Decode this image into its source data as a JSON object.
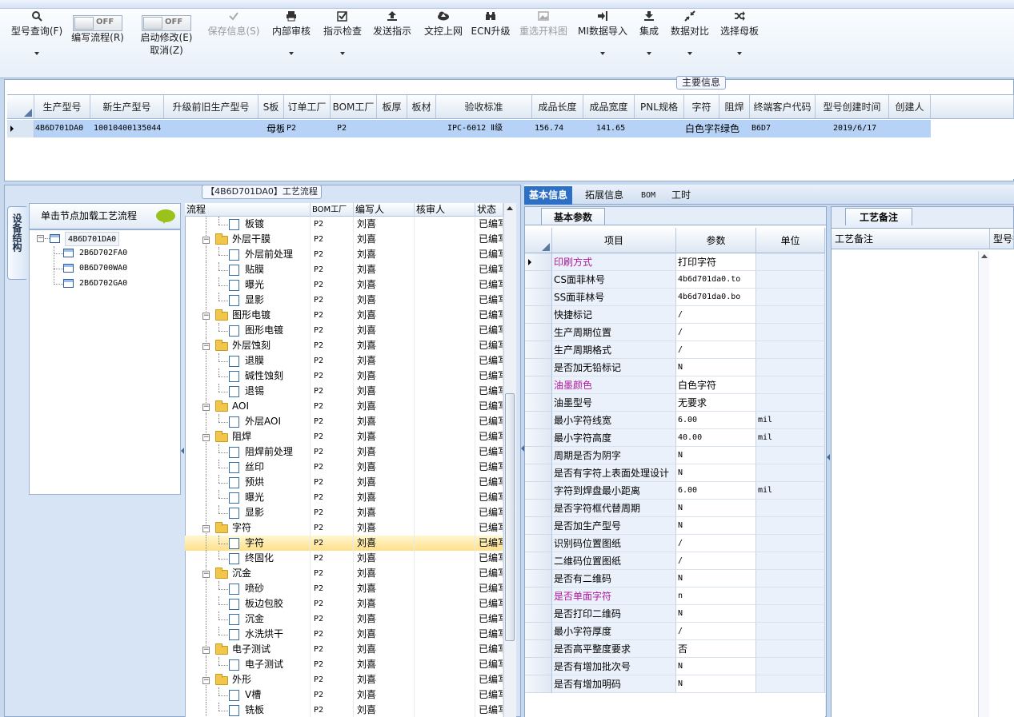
{
  "toolbar": {
    "query": "型号查询(F)",
    "edit_flow": "编写流程(R)",
    "edit_flow_toggle": "OFF",
    "enable_modify": "启动修改(E)",
    "enable_modify_toggle": "OFF",
    "cancel": "取消(Z)",
    "save_info": "保存信息(S)",
    "internal_review": "内部审核",
    "instruction_check": "指示检查",
    "send_instruction": "发送指示",
    "doc_upload": "文控上网",
    "ecn_upgrade": "ECN升级",
    "reselect_cut": "重选开料图",
    "mi_import": "MI数据导入",
    "integrate": "集成",
    "data_compare": "数据对比",
    "select_master": "选择母板"
  },
  "main_info": {
    "label": "主要信息",
    "columns": [
      "生产型号",
      "新生产型号",
      "升级前旧生产型号",
      "S板",
      "订单工厂",
      "BOM工厂",
      "板厚",
      "板材",
      "验收标准",
      "成品长度",
      "成品宽度",
      "PNL规格",
      "字符",
      "阻焊",
      "终端客户代码",
      "型号创建时间",
      "创建人"
    ],
    "row": {
      "model": "4B6D701DA0",
      "new_model": "10010400135044",
      "old_model": "",
      "s_board": "母板",
      "order_factory": "P2",
      "bom_factory": "P2",
      "thickness": "",
      "material": "",
      "standard": "IPC-6012 Ⅱ级",
      "length": "156.74",
      "width": "141.65",
      "pnl": "",
      "char": "白色字符",
      "solder": "绿色",
      "customer": "B6D7",
      "created": "2019/6/17",
      "creator": ""
    }
  },
  "tree": {
    "side_tab": "设备结构",
    "header": "单击节点加载工艺流程",
    "root": "4B6D701DA0",
    "children": [
      "2B6D702FA0",
      "0B6D700WA0",
      "2B6D702GA0"
    ]
  },
  "flow": {
    "title": "【4B6D701DA0】工艺流程",
    "columns": [
      "流程",
      "BOM工厂",
      "编写人",
      "核审人",
      "状态"
    ],
    "rows": [
      {
        "name": "板镀",
        "type": "child",
        "bom": "P2",
        "writer": "刘喜",
        "reviewer": "",
        "status": "已编写"
      },
      {
        "name": "外层干膜",
        "type": "group",
        "bom": "P2",
        "writer": "刘喜",
        "reviewer": "",
        "status": "已编写"
      },
      {
        "name": "外层前处理",
        "type": "child",
        "bom": "P2",
        "writer": "刘喜",
        "reviewer": "",
        "status": "已编写"
      },
      {
        "name": "贴膜",
        "type": "child",
        "bom": "P2",
        "writer": "刘喜",
        "reviewer": "",
        "status": "已编写"
      },
      {
        "name": "曝光",
        "type": "child",
        "bom": "P2",
        "writer": "刘喜",
        "reviewer": "",
        "status": "已编写"
      },
      {
        "name": "显影",
        "type": "child",
        "bom": "P2",
        "writer": "刘喜",
        "reviewer": "",
        "status": "已编写"
      },
      {
        "name": "图形电镀",
        "type": "group",
        "bom": "P2",
        "writer": "刘喜",
        "reviewer": "",
        "status": "已编写"
      },
      {
        "name": "图形电镀",
        "type": "child",
        "bom": "P2",
        "writer": "刘喜",
        "reviewer": "",
        "status": "已编写"
      },
      {
        "name": "外层蚀刻",
        "type": "group",
        "bom": "P2",
        "writer": "刘喜",
        "reviewer": "",
        "status": "已编写"
      },
      {
        "name": "退膜",
        "type": "child",
        "bom": "P2",
        "writer": "刘喜",
        "reviewer": "",
        "status": "已编写"
      },
      {
        "name": "碱性蚀刻",
        "type": "child",
        "bom": "P2",
        "writer": "刘喜",
        "reviewer": "",
        "status": "已编写"
      },
      {
        "name": "退锡",
        "type": "child",
        "bom": "P2",
        "writer": "刘喜",
        "reviewer": "",
        "status": "已编写"
      },
      {
        "name": "AOI",
        "type": "group",
        "bom": "P2",
        "writer": "刘喜",
        "reviewer": "",
        "status": "已编写"
      },
      {
        "name": "外层AOI",
        "type": "child",
        "bom": "P2",
        "writer": "刘喜",
        "reviewer": "",
        "status": "已编写"
      },
      {
        "name": "阻焊",
        "type": "group",
        "bom": "P2",
        "writer": "刘喜",
        "reviewer": "",
        "status": "已编写"
      },
      {
        "name": "阻焊前处理",
        "type": "child",
        "bom": "P2",
        "writer": "刘喜",
        "reviewer": "",
        "status": "已编写"
      },
      {
        "name": "丝印",
        "type": "child",
        "bom": "P2",
        "writer": "刘喜",
        "reviewer": "",
        "status": "已编写"
      },
      {
        "name": "预烘",
        "type": "child",
        "bom": "P2",
        "writer": "刘喜",
        "reviewer": "",
        "status": "已编写"
      },
      {
        "name": "曝光",
        "type": "child",
        "bom": "P2",
        "writer": "刘喜",
        "reviewer": "",
        "status": "已编写"
      },
      {
        "name": "显影",
        "type": "child",
        "bom": "P2",
        "writer": "刘喜",
        "reviewer": "",
        "status": "已编写"
      },
      {
        "name": "字符",
        "type": "group",
        "bom": "P2",
        "writer": "刘喜",
        "reviewer": "",
        "status": "已编写"
      },
      {
        "name": "字符",
        "type": "child",
        "bom": "P2",
        "writer": "刘喜",
        "reviewer": "",
        "status": "已编写",
        "selected": true
      },
      {
        "name": "终固化",
        "type": "child",
        "bom": "P2",
        "writer": "刘喜",
        "reviewer": "",
        "status": "已编写"
      },
      {
        "name": "沉金",
        "type": "group",
        "bom": "P2",
        "writer": "刘喜",
        "reviewer": "",
        "status": "已编写"
      },
      {
        "name": "喷砂",
        "type": "child",
        "bom": "P2",
        "writer": "刘喜",
        "reviewer": "",
        "status": "已编写"
      },
      {
        "name": "板边包胶",
        "type": "child",
        "bom": "P2",
        "writer": "刘喜",
        "reviewer": "",
        "status": "已编写"
      },
      {
        "name": "沉金",
        "type": "child",
        "bom": "P2",
        "writer": "刘喜",
        "reviewer": "",
        "status": "已编写"
      },
      {
        "name": "水洗烘干",
        "type": "child",
        "bom": "P2",
        "writer": "刘喜",
        "reviewer": "",
        "status": "已编写"
      },
      {
        "name": "电子测试",
        "type": "group",
        "bom": "P2",
        "writer": "刘喜",
        "reviewer": "",
        "status": "已编写"
      },
      {
        "name": "电子测试",
        "type": "child",
        "bom": "P2",
        "writer": "刘喜",
        "reviewer": "",
        "status": "已编写"
      },
      {
        "name": "外形",
        "type": "group",
        "bom": "P2",
        "writer": "刘喜",
        "reviewer": "",
        "status": "已编写"
      },
      {
        "name": "V槽",
        "type": "child",
        "bom": "P2",
        "writer": "刘喜",
        "reviewer": "",
        "status": "已编写"
      },
      {
        "name": "铣板",
        "type": "child",
        "bom": "P2",
        "writer": "刘喜",
        "reviewer": "",
        "status": "已编写"
      }
    ]
  },
  "right_tabs": [
    "基本信息",
    "拓展信息",
    "BOM",
    "工时"
  ],
  "basic": {
    "tab": "基本参数",
    "columns": [
      "项目",
      "参数",
      "单位"
    ],
    "rows": [
      {
        "item": "印刷方式",
        "value": "打印字符",
        "unit": "",
        "highlight": true
      },
      {
        "item": "CS面菲林号",
        "value": "4b6d701da0.to",
        "unit": ""
      },
      {
        "item": "SS面菲林号",
        "value": "4b6d701da0.bo",
        "unit": ""
      },
      {
        "item": "快捷标记",
        "value": "/",
        "unit": ""
      },
      {
        "item": "生产周期位置",
        "value": "/",
        "unit": ""
      },
      {
        "item": "生产周期格式",
        "value": "/",
        "unit": ""
      },
      {
        "item": "是否加无铅标记",
        "value": "N",
        "unit": ""
      },
      {
        "item": "油墨颜色",
        "value": "白色字符",
        "unit": "",
        "highlight": true
      },
      {
        "item": "油墨型号",
        "value": "无要求",
        "unit": ""
      },
      {
        "item": "最小字符线宽",
        "value": "6.00",
        "unit": "mil"
      },
      {
        "item": "最小字符高度",
        "value": "40.00",
        "unit": "mil"
      },
      {
        "item": "周期是否为阴字",
        "value": "N",
        "unit": ""
      },
      {
        "item": "是否有字符上表面处理设计",
        "value": "N",
        "unit": ""
      },
      {
        "item": "字符到焊盘最小距离",
        "value": "6.00",
        "unit": "mil"
      },
      {
        "item": "是否字符框代替周期",
        "value": "N",
        "unit": ""
      },
      {
        "item": "是否加生产型号",
        "value": "N",
        "unit": ""
      },
      {
        "item": "识别码位置图纸",
        "value": "/",
        "unit": ""
      },
      {
        "item": "二维码位置图纸",
        "value": "/",
        "unit": ""
      },
      {
        "item": "是否有二维码",
        "value": "N",
        "unit": ""
      },
      {
        "item": "是否单面字符",
        "value": "n",
        "unit": "",
        "highlight": true
      },
      {
        "item": "是否打印二维码",
        "value": "N",
        "unit": ""
      },
      {
        "item": "最小字符厚度",
        "value": "/",
        "unit": ""
      },
      {
        "item": "是否高平整度要求",
        "value": "否",
        "unit": ""
      },
      {
        "item": "是否有增加批次号",
        "value": "N",
        "unit": ""
      },
      {
        "item": "是否有增加明码",
        "value": "N",
        "unit": ""
      }
    ]
  },
  "notes": {
    "tab": "工艺备注",
    "columns": [
      "工艺备注",
      "型号行"
    ]
  },
  "colors": {
    "highlight_text": "#b0179a",
    "tab_active": "#2c6fc4",
    "row_selected": "#b6d2f7"
  }
}
